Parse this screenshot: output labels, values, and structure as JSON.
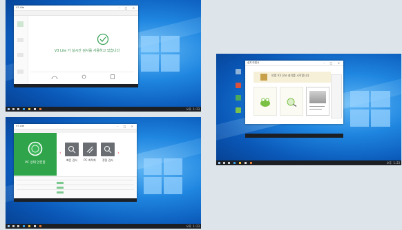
{
  "panels": {
    "top_left": {
      "window_title": "V3 Lite",
      "status_message": "V3 Lite 가 실시간 검사를 사용하고 있습니다"
    },
    "bottom_left": {
      "window_title": "V3 Lite",
      "pc_status": "PC 상태 안전함",
      "tile_labels": [
        "빠른 검사",
        "PC 최적화",
        "정밀 검사"
      ]
    },
    "right": {
      "window_title": "설치 마법사",
      "banner_text": "안랩 V3 Lite 설치를 시작합니다"
    }
  },
  "taskbar": {
    "clock": "오후 1:23"
  },
  "colors": {
    "accent_green": "#2fa44a",
    "desktop_blue": "#1f86e0"
  }
}
